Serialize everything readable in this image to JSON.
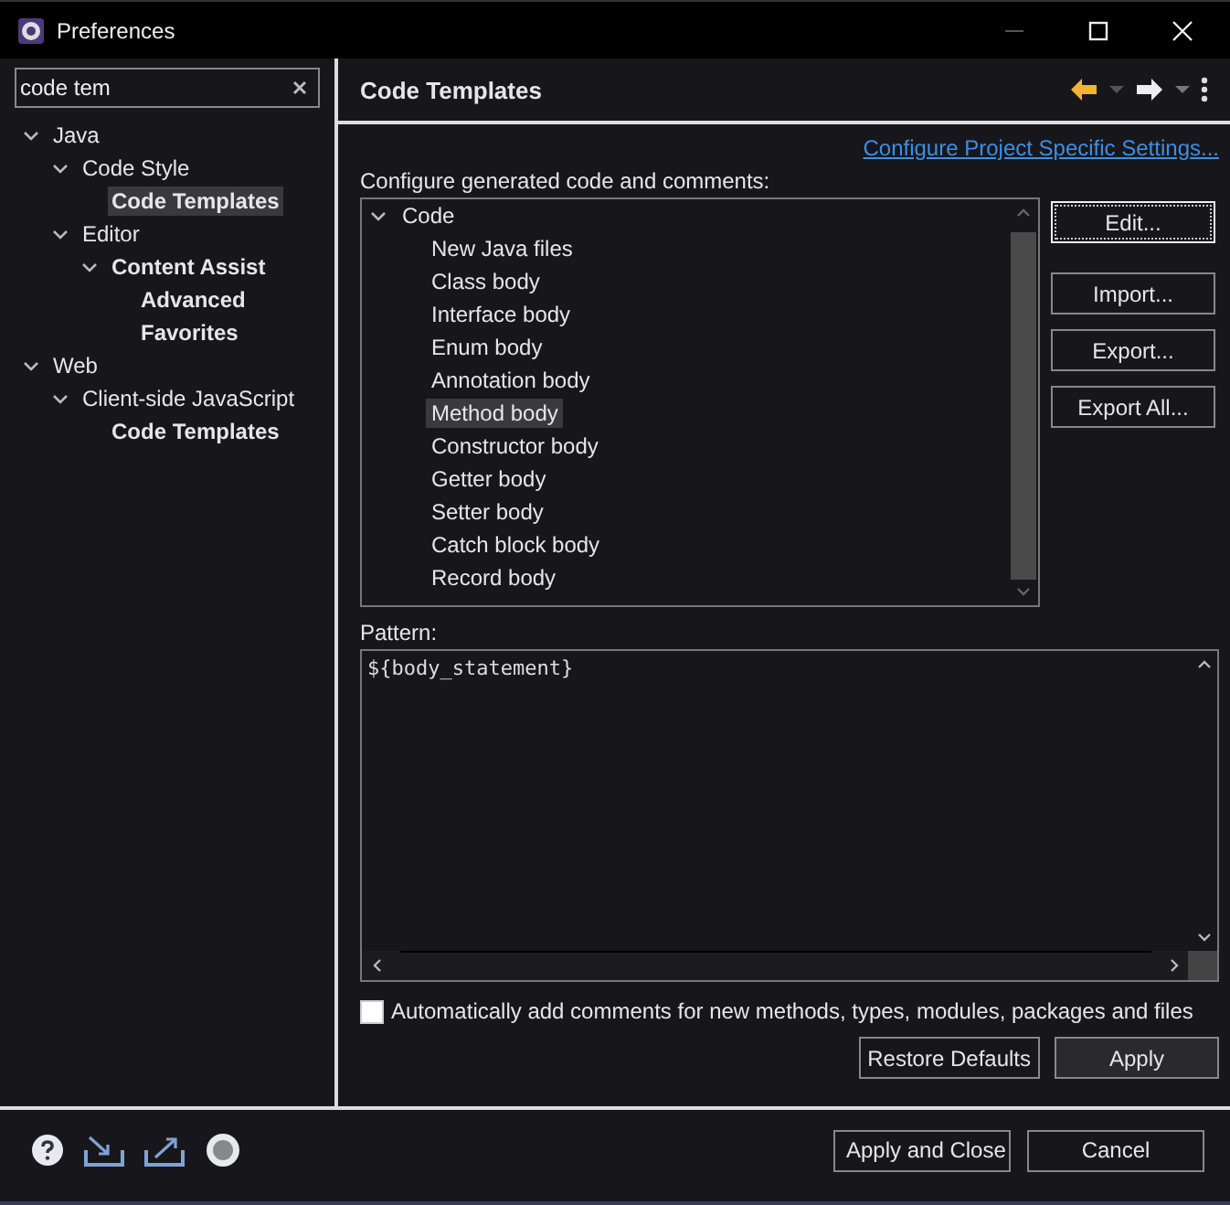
{
  "window": {
    "title": "Preferences"
  },
  "filter": {
    "value": "code tem"
  },
  "tree": [
    {
      "label": "Java",
      "expanded": true,
      "matched": false,
      "selected": false,
      "children": [
        {
          "label": "Code Style",
          "expanded": true,
          "matched": false,
          "selected": false,
          "children": [
            {
              "label": "Code Templates",
              "matched": true,
              "selected": true
            }
          ]
        },
        {
          "label": "Editor",
          "expanded": true,
          "matched": false,
          "selected": false,
          "children": [
            {
              "label": "Content Assist",
              "expanded": true,
              "matched": true,
              "selected": false,
              "children": [
                {
                  "label": "Advanced",
                  "matched": true,
                  "selected": false
                },
                {
                  "label": "Favorites",
                  "matched": true,
                  "selected": false
                }
              ]
            }
          ]
        }
      ]
    },
    {
      "label": "Web",
      "expanded": true,
      "matched": false,
      "selected": false,
      "children": [
        {
          "label": "Client-side JavaScript",
          "expanded": true,
          "matched": false,
          "selected": false,
          "children": [
            {
              "label": "Code Templates",
              "matched": true,
              "selected": false
            }
          ]
        }
      ]
    }
  ],
  "page": {
    "title": "Code Templates",
    "link": "Configure Project Specific Settings...",
    "intro": "Configure generated code and comments:",
    "templates": [
      {
        "label": "Code",
        "expanded": true,
        "selected": false,
        "children": [
          {
            "label": "New Java files",
            "selected": false
          },
          {
            "label": "Class body",
            "selected": false
          },
          {
            "label": "Interface body",
            "selected": false
          },
          {
            "label": "Enum body",
            "selected": false
          },
          {
            "label": "Annotation body",
            "selected": false
          },
          {
            "label": "Method body",
            "selected": true
          },
          {
            "label": "Constructor body",
            "selected": false
          },
          {
            "label": "Getter body",
            "selected": false
          },
          {
            "label": "Setter body",
            "selected": false
          },
          {
            "label": "Catch block body",
            "selected": false
          },
          {
            "label": "Record body",
            "selected": false
          }
        ]
      }
    ],
    "side_buttons": [
      {
        "label": "Edit...",
        "focused": true
      },
      {
        "label": "Import...",
        "focused": false
      },
      {
        "label": "Export...",
        "focused": false
      },
      {
        "label": "Export All...",
        "focused": false
      }
    ],
    "pattern_label": "Pattern:",
    "pattern": "${body_statement}",
    "auto_comments": {
      "label": "Automatically add comments for new methods, types, modules, packages and files",
      "checked": false
    },
    "buttons": [
      "Restore Defaults",
      "Apply"
    ]
  },
  "footer": {
    "buttons": [
      "Apply and Close",
      "Cancel"
    ]
  }
}
